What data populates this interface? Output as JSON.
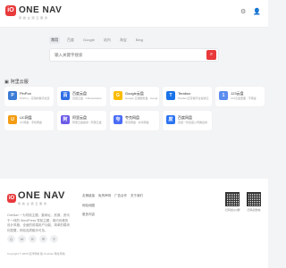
{
  "header": {
    "logo_mark": "iO",
    "logo_text": "ONE NAV",
    "logo_sub": "导 航 主 题 云 服 务",
    "icons": [
      "settings-icon",
      "user-icon"
    ]
  },
  "search": {
    "tabs": [
      "常用",
      "百度",
      "Google",
      "站内",
      "淘宝",
      "Bing"
    ],
    "active_tab": 0,
    "placeholder": "输入关键字搜索",
    "button_icon": "search-icon"
  },
  "section": {
    "icon": "server-icon",
    "title": "阿里云服"
  },
  "cards": [
    {
      "title": "PinPon",
      "desc": "PinPon，实用的聊天社区",
      "icon_color": "#3a7bd5",
      "icon_char": "P"
    },
    {
      "title": "百度云盘",
      "desc": "百度云盘 · ChineseGlow",
      "icon_color": "#2f6fe4",
      "icon_char": "百"
    },
    {
      "title": "Google云盘",
      "desc": "Google 云储服务盘 · Google",
      "icon_color": "#fbbc05",
      "icon_char": "G"
    },
    {
      "title": "Terabox",
      "desc": "Terabox云存储平台提供云",
      "icon_color": "#1a73e8",
      "icon_char": "T"
    },
    {
      "title": "123云盘",
      "desc": "123云盘里面 · 不限速",
      "icon_color": "#5b8def",
      "icon_char": "1"
    },
    {
      "title": "UC网盘",
      "desc": "UC网盘 · 手机网盘",
      "icon_color": "#f39c12",
      "icon_char": "U"
    },
    {
      "title": "阿里云盘",
      "desc": "阿里云盘提供 · 阿里云盘",
      "icon_color": "#6d5ce7",
      "icon_char": "阿"
    },
    {
      "title": "夸克网盘",
      "desc": "夸克网盘 · 共享网盘",
      "icon_color": "#4a6cf7",
      "icon_char": "夸"
    },
    {
      "title": "百度网盘",
      "desc": "百度一款百度公司推出的",
      "icon_color": "#2b73f1",
      "icon_char": "度"
    }
  ],
  "footer": {
    "logo_mark": "iO",
    "logo_text": "ONE NAV",
    "logo_sub": "导 航 主 题 云 服 务",
    "desc": "OneNav 一为导航主题，集网址、资源、资讯于一体的 WordPress 导航主题，简约优雅的设计风格，全面的前端用户功能，简单的模块化配置，网站品质触手可及。",
    "links_row": [
      "友情链接",
      "免责声明",
      "广告合作",
      "关于我们"
    ],
    "links_col": [
      "网站地图",
      "更多内容"
    ],
    "social": [
      "qq-icon",
      "wechat-icon",
      "weibo-icon",
      "mail-icon",
      "link-icon"
    ],
    "qr_captions": [
      "扫码加QQ群",
      "扫码加微信"
    ],
    "copyright": "Copyright © 2025 远洋导航 版 OneNav 网址导航"
  }
}
